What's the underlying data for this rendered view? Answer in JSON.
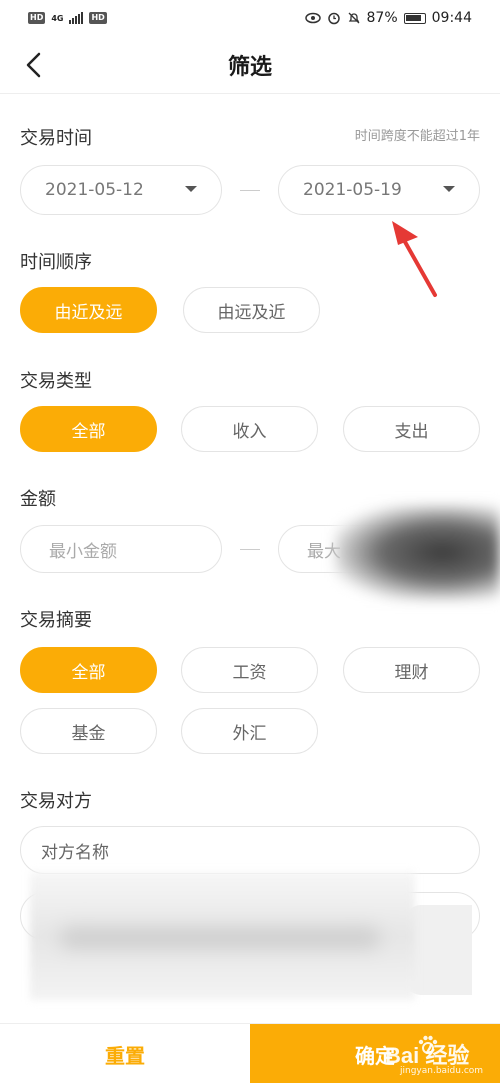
{
  "statusbar": {
    "left_badge_1": "HD",
    "network": "4G",
    "left_badge_2": "HD",
    "battery": "87%",
    "time": "09:44"
  },
  "header": {
    "title": "筛选"
  },
  "trade_time": {
    "title": "交易时间",
    "hint": "时间跨度不能超过1年",
    "start_date": "2021-05-12",
    "end_date": "2021-05-19"
  },
  "time_order": {
    "title": "时间顺序",
    "options": [
      "由近及远",
      "由远及近"
    ],
    "selected": 0
  },
  "trade_type": {
    "title": "交易类型",
    "options": [
      "全部",
      "收入",
      "支出"
    ],
    "selected": 0
  },
  "amount": {
    "title": "金额",
    "min_placeholder": "最小金额",
    "max_placeholder_partial": "最大"
  },
  "summary": {
    "title": "交易摘要",
    "options": [
      "全部",
      "工资",
      "理财",
      "基金",
      "外汇"
    ],
    "selected": 0
  },
  "counterparty": {
    "title": "交易对方",
    "name_placeholder": "对方名称"
  },
  "footer": {
    "reset_label": "重置",
    "confirm_label": "确定"
  },
  "watermark": {
    "brand": "Bai 经验",
    "url": "jingyan.baidu.com"
  },
  "colors": {
    "accent": "#fbac06",
    "arrow": "#e53935"
  }
}
